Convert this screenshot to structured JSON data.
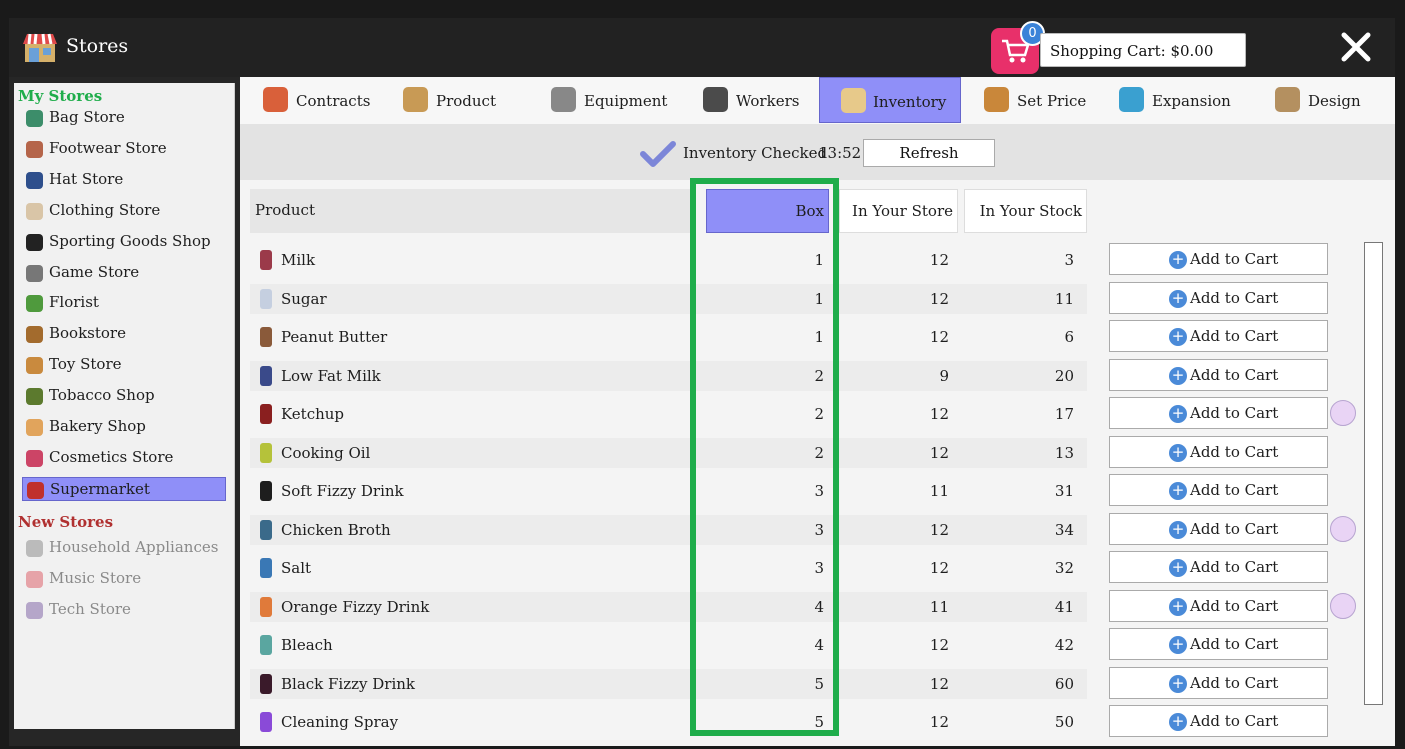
{
  "window": {
    "title": "Stores"
  },
  "cart": {
    "count": "0",
    "label": "Shopping Cart: $0.00"
  },
  "sidebar": {
    "my_stores_header": "My Stores",
    "my_stores": [
      {
        "label": "Bag Store",
        "icon": "bag-icon",
        "color": "#3c8d6a"
      },
      {
        "label": "Footwear Store",
        "icon": "shoe-icon",
        "color": "#b5654a"
      },
      {
        "label": "Hat Store",
        "icon": "hat-icon",
        "color": "#2e4f8c"
      },
      {
        "label": "Clothing Store",
        "icon": "shirt-icon",
        "color": "#d9c5a7"
      },
      {
        "label": "Sporting Goods Shop",
        "icon": "soccer-ball-icon",
        "color": "#222222"
      },
      {
        "label": "Game Store",
        "icon": "gamepad-icon",
        "color": "#777777"
      },
      {
        "label": "Florist",
        "icon": "flower-pot-icon",
        "color": "#4f9a3d"
      },
      {
        "label": "Bookstore",
        "icon": "book-icon",
        "color": "#a36b2d"
      },
      {
        "label": "Toy Store",
        "icon": "teddy-bear-icon",
        "color": "#c98a3e"
      },
      {
        "label": "Tobacco Shop",
        "icon": "leaf-icon",
        "color": "#5c7a2e"
      },
      {
        "label": "Bakery Shop",
        "icon": "cupcake-icon",
        "color": "#e1a45c"
      },
      {
        "label": "Cosmetics Store",
        "icon": "cosmetics-icon",
        "color": "#cc4466"
      },
      {
        "label": "Supermarket",
        "icon": "basket-icon",
        "color": "#c0302c"
      }
    ],
    "new_stores_header": "New Stores",
    "new_stores": [
      {
        "label": "Household Appliances",
        "icon": "appliance-icon",
        "color": "#bbbbbb"
      },
      {
        "label": "Music Store",
        "icon": "guitar-icon",
        "color": "#e6a3a8"
      },
      {
        "label": "Tech Store",
        "icon": "computer-icon",
        "color": "#b5a6c9"
      }
    ]
  },
  "tabs": [
    {
      "label": "Contracts",
      "icon": "contract-pencil-icon",
      "color": "#d9603a"
    },
    {
      "label": "Product",
      "icon": "box-icon",
      "color": "#c89a55"
    },
    {
      "label": "Equipment",
      "icon": "shelf-icon",
      "color": "#888888"
    },
    {
      "label": "Workers",
      "icon": "worker-icon",
      "color": "#4b4b4b"
    },
    {
      "label": "Inventory",
      "icon": "clipboard-icon",
      "color": "#e7c98a"
    },
    {
      "label": "Set Price",
      "icon": "price-tag-icon",
      "color": "#c9873a"
    },
    {
      "label": "Expansion",
      "icon": "expand-arrows-icon",
      "color": "#3aa0d0"
    },
    {
      "label": "Design",
      "icon": "paint-brush-icon",
      "color": "#b49060"
    }
  ],
  "status": {
    "text": "Inventory Checked",
    "time": "13:52",
    "refresh_label": "Refresh"
  },
  "table": {
    "headers": {
      "product": "Product",
      "box": "Box",
      "store": "In Your Store",
      "stock": "In Your Stock"
    },
    "add_label": "Add to Cart",
    "rows": [
      {
        "name": "Milk",
        "box": "1",
        "store": "12",
        "stock": "3",
        "color": "#9b3a4a",
        "promo": false
      },
      {
        "name": "Sugar",
        "box": "1",
        "store": "12",
        "stock": "11",
        "color": "#c5cfe0",
        "promo": false
      },
      {
        "name": "Peanut Butter",
        "box": "1",
        "store": "12",
        "stock": "6",
        "color": "#8a5a3a",
        "promo": false
      },
      {
        "name": "Low Fat Milk",
        "box": "2",
        "store": "9",
        "stock": "20",
        "color": "#3a4a8a",
        "promo": false
      },
      {
        "name": "Ketchup",
        "box": "2",
        "store": "12",
        "stock": "17",
        "color": "#8a1f1f",
        "promo": true
      },
      {
        "name": "Cooking Oil",
        "box": "2",
        "store": "12",
        "stock": "13",
        "color": "#b5c23a",
        "promo": false
      },
      {
        "name": "Soft Fizzy Drink",
        "box": "3",
        "store": "11",
        "stock": "31",
        "color": "#1e1e1e",
        "promo": false
      },
      {
        "name": "Chicken Broth",
        "box": "3",
        "store": "12",
        "stock": "34",
        "color": "#3a6a8a",
        "promo": true
      },
      {
        "name": "Salt",
        "box": "3",
        "store": "12",
        "stock": "32",
        "color": "#3a78b5",
        "promo": false
      },
      {
        "name": "Orange Fizzy Drink",
        "box": "4",
        "store": "11",
        "stock": "41",
        "color": "#e07a3a",
        "promo": true
      },
      {
        "name": "Bleach",
        "box": "4",
        "store": "12",
        "stock": "42",
        "color": "#5aa6a0",
        "promo": false
      },
      {
        "name": "Black Fizzy Drink",
        "box": "5",
        "store": "12",
        "stock": "60",
        "color": "#3a1a2a",
        "promo": false
      },
      {
        "name": "Cleaning Spray",
        "box": "5",
        "store": "12",
        "stock": "50",
        "color": "#8a4ad8",
        "promo": false
      }
    ]
  },
  "colors": {
    "selected": "#8f8ff8",
    "highlight": "#1fad4b",
    "my_stores_header": "#1fad4b",
    "new_stores_header": "#b03030",
    "cart": "#e8306a"
  }
}
